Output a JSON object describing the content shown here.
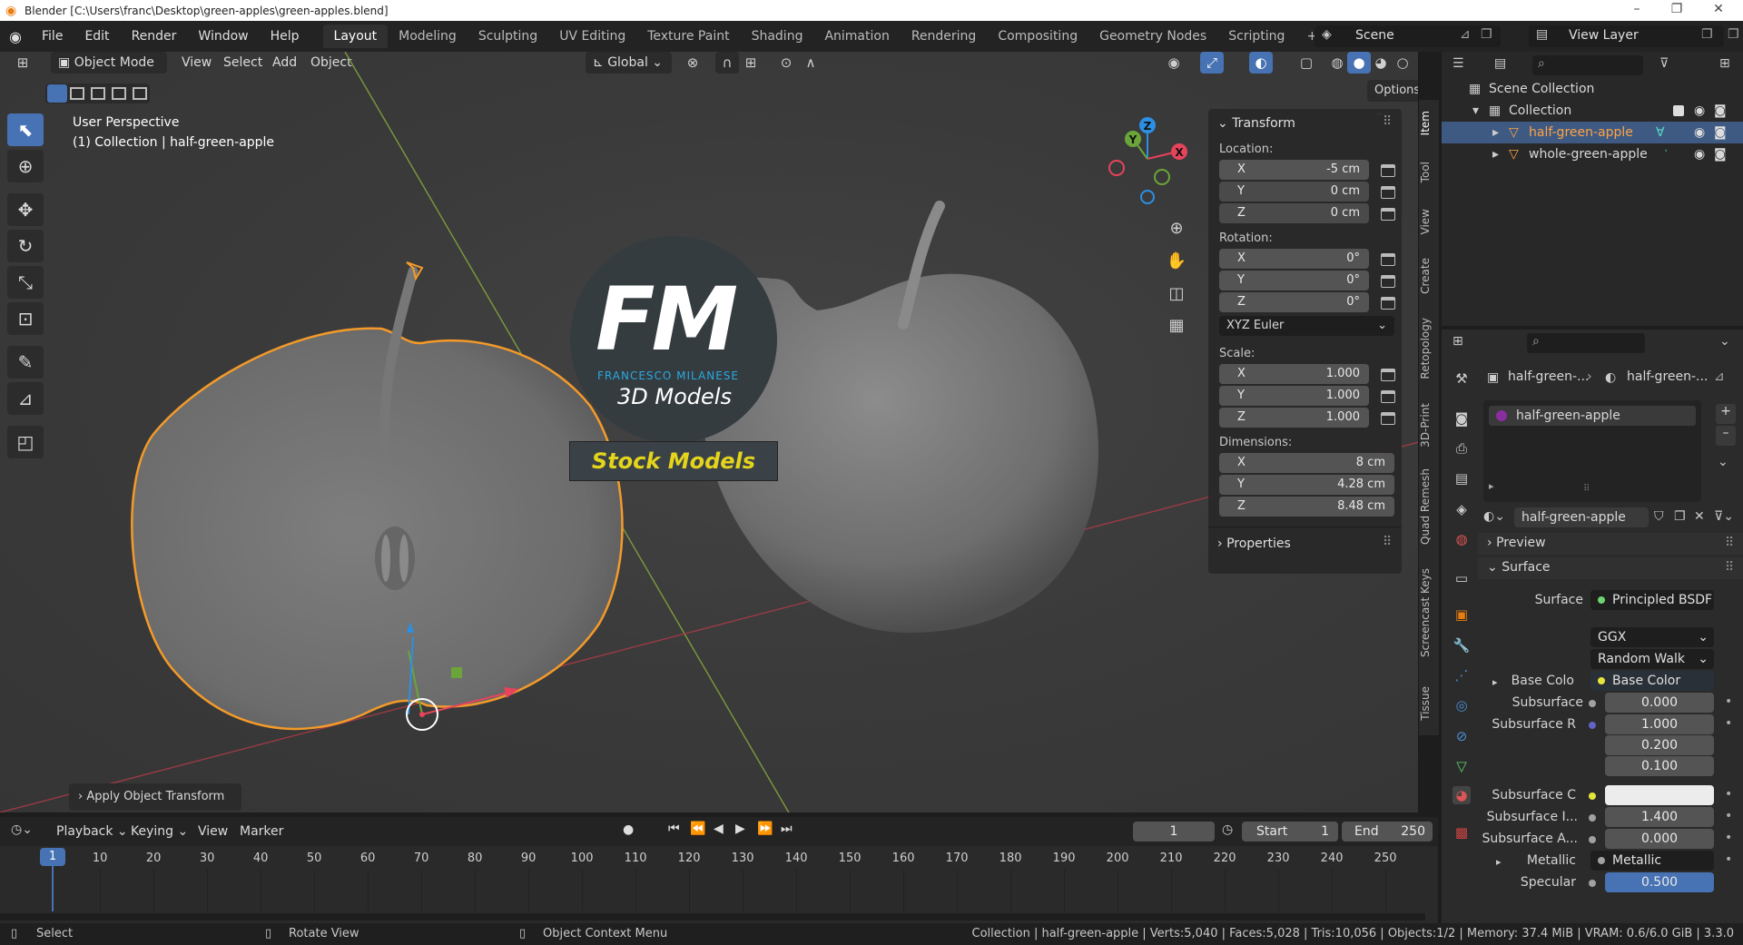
{
  "window": {
    "title": "Blender [C:\\Users\\franc\\Desktop\\green-apples\\green-apples.blend]"
  },
  "menu": [
    "File",
    "Edit",
    "Render",
    "Window",
    "Help"
  ],
  "workspaces": [
    "Layout",
    "Modeling",
    "Sculpting",
    "UV Editing",
    "Texture Paint",
    "Shading",
    "Animation",
    "Rendering",
    "Compositing",
    "Geometry Nodes",
    "Scripting"
  ],
  "scene": {
    "name": "Scene",
    "view_layer": "View Layer"
  },
  "viewport": {
    "mode": "Object Mode",
    "menus": [
      "View",
      "Select",
      "Add",
      "Object"
    ],
    "orientation": "Global",
    "options": "Options",
    "overlay_title": "User Perspective",
    "overlay_sub": "(1) Collection | half-green-apple",
    "last_op": "Apply Object Transform",
    "gizmo": {
      "x": "X",
      "y": "Y",
      "z": "Z"
    }
  },
  "logo": {
    "fm": "FM",
    "name": "FRANCESCO MILANESE",
    "sub": "3D Models",
    "banner": "Stock Models"
  },
  "npanel": {
    "transform": "Transform",
    "location_label": "Location:",
    "location": [
      {
        "axis": "X",
        "value": "-5 cm"
      },
      {
        "axis": "Y",
        "value": "0 cm"
      },
      {
        "axis": "Z",
        "value": "0 cm"
      }
    ],
    "rotation_label": "Rotation:",
    "rotation": [
      {
        "axis": "X",
        "value": "0°"
      },
      {
        "axis": "Y",
        "value": "0°"
      },
      {
        "axis": "Z",
        "value": "0°"
      }
    ],
    "rotation_mode": "XYZ Euler",
    "scale_label": "Scale:",
    "scale": [
      {
        "axis": "X",
        "value": "1.000"
      },
      {
        "axis": "Y",
        "value": "1.000"
      },
      {
        "axis": "Z",
        "value": "1.000"
      }
    ],
    "dimensions_label": "Dimensions:",
    "dimensions": [
      {
        "axis": "X",
        "value": "8 cm"
      },
      {
        "axis": "Y",
        "value": "4.28 cm"
      },
      {
        "axis": "Z",
        "value": "8.48 cm"
      }
    ],
    "properties": "Properties"
  },
  "side_tabs": [
    "Item",
    "Tool",
    "View",
    "Create",
    "Retopology",
    "3D-Print",
    "Quad Remesh",
    "Screencast Keys",
    "Tissue"
  ],
  "outliner": {
    "scene_collection": "Scene Collection",
    "collection": "Collection",
    "objects": [
      "half-green-apple",
      "whole-green-apple"
    ]
  },
  "properties": {
    "breadcrumb_obj": "half-green-...",
    "breadcrumb_mat": "half-green-...",
    "slot": "half-green-apple",
    "material": "half-green-apple",
    "preview": "Preview",
    "surface_panel": "Surface",
    "surface_label": "Surface",
    "surface_value": "Principled BSDF",
    "distribution": "GGX",
    "subsurface_method": "Random Walk",
    "rows": [
      {
        "label": "Base Colo",
        "value": "Base Color",
        "kind": "link"
      },
      {
        "label": "Subsurface",
        "value": "0.000",
        "kind": "num"
      },
      {
        "label": "Subsurface R",
        "value": "1.000",
        "kind": "num"
      },
      {
        "label": "",
        "value": "0.200",
        "kind": "num"
      },
      {
        "label": "",
        "value": "0.100",
        "kind": "num"
      },
      {
        "label": "Subsurface C",
        "value": "",
        "kind": "color"
      },
      {
        "label": "Subsurface I...",
        "value": "1.400",
        "kind": "num"
      },
      {
        "label": "Subsurface A...",
        "value": "0.000",
        "kind": "num"
      },
      {
        "label": "Metallic",
        "value": "Metallic",
        "kind": "link"
      },
      {
        "label": "Specular",
        "value": "0.500",
        "kind": "num"
      }
    ]
  },
  "timeline": {
    "menus": [
      "Playback",
      "Keying",
      "View",
      "Marker"
    ],
    "current": "1",
    "start_label": "Start",
    "start": "1",
    "end_label": "End",
    "end": "250",
    "ticks": [
      "1",
      "10",
      "20",
      "30",
      "40",
      "50",
      "60",
      "70",
      "80",
      "90",
      "100",
      "110",
      "120",
      "130",
      "140",
      "150",
      "160",
      "170",
      "180",
      "190",
      "200",
      "210",
      "220",
      "230",
      "240",
      "250"
    ]
  },
  "status": {
    "select": "Select",
    "rotate": "Rotate View",
    "context": "Object Context Menu",
    "info": "Collection | half-green-apple | Verts:5,040 | Faces:5,028 | Tris:10,056 | Objects:1/2 | Memory: 37.4 MiB | VRAM: 0.6/6.0 GiB | 3.3.0"
  },
  "colors": {
    "accent": "#4772b3",
    "selection": "#ffa347",
    "x_axis": "#e5445b",
    "y_axis": "#6ba539",
    "z_axis": "#2c8fe3"
  }
}
